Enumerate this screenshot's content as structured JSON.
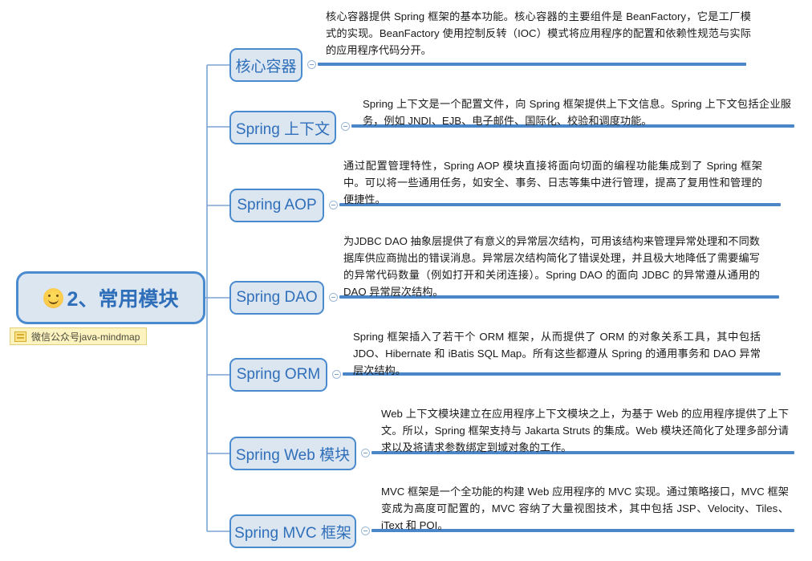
{
  "root": {
    "emoji": "smiling-face-emoji",
    "label": "2、常用模块"
  },
  "note": {
    "icon": "note-icon",
    "text": "微信公众号java-mindmap"
  },
  "colors": {
    "node_fill": "#dce6f1",
    "node_border": "#4a8bd0",
    "node_text": "#2f6fba",
    "rule": "#4a86c8",
    "note_fill": "#fdf3c0"
  },
  "branches": [
    {
      "label": "核心容器",
      "description": "核心容器提供 Spring 框架的基本功能。核心容器的主要组件是 BeanFactory，它是工厂模式的实现。BeanFactory 使用控制反转（IOC）模式将应用程序的配置和依赖性规范与实际的应用程序代码分开。"
    },
    {
      "label": "Spring 上下文",
      "description": "Spring 上下文是一个配置文件，向 Spring 框架提供上下文信息。Spring 上下文包括企业服务，例如 JNDI、EJB、电子邮件、国际化、校验和调度功能。"
    },
    {
      "label": "Spring AOP",
      "description": "通过配置管理特性，Spring AOP 模块直接将面向切面的编程功能集成到了 Spring 框架中。可以将一些通用任务，如安全、事务、日志等集中进行管理，提高了复用性和管理的便捷性。"
    },
    {
      "label": "Spring DAO",
      "description": "为JDBC DAO 抽象层提供了有意义的异常层次结构，可用该结构来管理异常处理和不同数据库供应商抛出的错误消息。异常层次结构简化了错误处理，并且极大地降低了需要编写的异常代码数量（例如打开和关闭连接）。Spring DAO 的面向 JDBC 的异常遵从通用的 DAO 异常层次结构。"
    },
    {
      "label": "Spring ORM",
      "description": "Spring 框架插入了若干个 ORM 框架，从而提供了 ORM 的对象关系工具，其中包括 JDO、Hibernate 和 iBatis SQL Map。所有这些都遵从 Spring 的通用事务和 DAO 异常层次结构。"
    },
    {
      "label": "Spring Web 模块",
      "description": "Web 上下文模块建立在应用程序上下文模块之上，为基于 Web 的应用程序提供了上下文。所以，Spring 框架支持与 Jakarta Struts 的集成。Web 模块还简化了处理多部分请求以及将请求参数绑定到域对象的工作。"
    },
    {
      "label": "Spring MVC 框架",
      "description": "MVC 框架是一个全功能的构建 Web 应用程序的 MVC 实现。通过策略接口，MVC 框架变成为高度可配置的，MVC 容纳了大量视图技术，其中包括 JSP、Velocity、Tiles、iText 和 POI。"
    }
  ]
}
